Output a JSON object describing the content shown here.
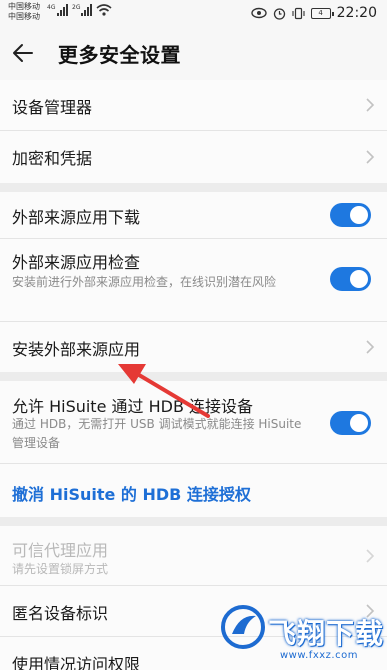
{
  "status_bar": {
    "carrier1": "中国移动",
    "carrier2": "中国移动",
    "net1": "4G",
    "net2": "2G",
    "time": "22:20",
    "battery": "4"
  },
  "header": {
    "title": "更多安全设置"
  },
  "group1": {
    "items": [
      {
        "label": "设备管理器"
      },
      {
        "label": "加密和凭据"
      }
    ]
  },
  "group2": {
    "items": [
      {
        "label": "外部来源应用下载",
        "toggle": true
      },
      {
        "label": "外部来源应用检查",
        "sub": "安装前进行外部来源应用检查，在线识别潜在风险",
        "toggle": true
      },
      {
        "label": "安装外部来源应用"
      }
    ]
  },
  "group3": {
    "hisuite_label": "允许 HiSuite 通过 HDB 连接设备",
    "hisuite_sub": "通过 HDB，无需打开 USB 调试模式就能连接 HiSuite 管理设备",
    "hisuite_toggle": true,
    "revoke_link": "撤消 HiSuite 的 HDB 连接授权"
  },
  "group4": {
    "items": [
      {
        "label": "可信代理应用",
        "sub": "请先设置锁屏方式",
        "disabled": true
      },
      {
        "label": "匿名设备标识"
      },
      {
        "label": "使用情况访问权限"
      }
    ]
  },
  "watermark": {
    "text": "飞翔下载",
    "url": "www.fxxz.com"
  },
  "colors": {
    "accent": "#1e78e0",
    "link": "#1e6fd6",
    "annotation_arrow": "#e53935"
  }
}
